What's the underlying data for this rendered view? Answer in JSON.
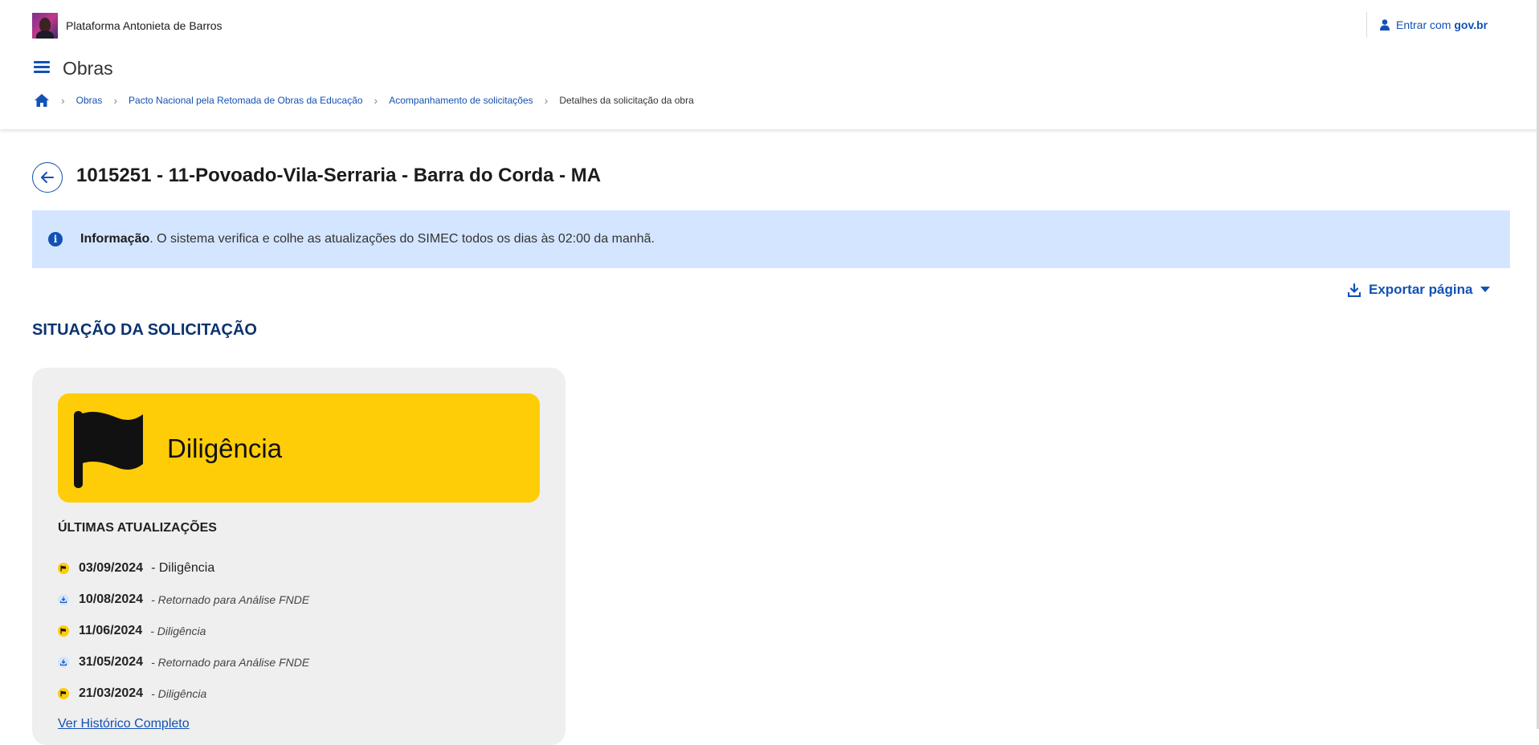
{
  "header": {
    "platform_name": "Plataforma Antonieta de Barros",
    "login_label": "Entrar com",
    "login_brand": "gov.br",
    "section_title": "Obras"
  },
  "breadcrumb": {
    "items": [
      "Obras",
      "Pacto Nacional pela Retomada de Obras da Educação",
      "Acompanhamento de solicitações"
    ],
    "current": "Detalhes da solicitação da obra"
  },
  "page": {
    "title": "1015251 - 11-Povoado-Vila-Serraria - Barra do Corda - MA"
  },
  "info": {
    "label": "Informação",
    "text": ". O sistema verifica e colhe as atualizações do SIMEC todos os dias às 02:00 da manhã."
  },
  "export": {
    "label": "Exportar página"
  },
  "status": {
    "heading": "SITUAÇÃO DA SOLICITAÇÃO",
    "current": "Diligência",
    "updates_title": "ÚLTIMAS ATUALIZAÇÕES",
    "updates": [
      {
        "date": "03/09/2024",
        "desc": "- Diligência",
        "kind": "flag"
      },
      {
        "date": "10/08/2024",
        "desc": "- Retornado para Análise FNDE",
        "kind": "return"
      },
      {
        "date": "11/06/2024",
        "desc": "- Diligência",
        "kind": "flag"
      },
      {
        "date": "31/05/2024",
        "desc": "- Retornado para Análise FNDE",
        "kind": "return"
      },
      {
        "date": "21/03/2024",
        "desc": "- Diligência",
        "kind": "flag"
      }
    ],
    "history_link": "Ver Histórico Completo"
  },
  "colors": {
    "primary": "#1351b4",
    "info_bg": "#d4e5ff",
    "status_yellow": "#ffcd07",
    "heading_blue": "#0c326f"
  }
}
